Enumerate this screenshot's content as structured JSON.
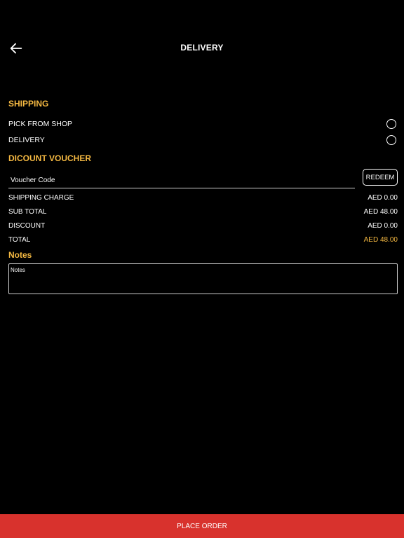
{
  "header": {
    "title": "DELIVERY",
    "back_icon": "arrow-left-icon"
  },
  "shipping": {
    "title": "SHIPPING",
    "options": [
      {
        "label": "PICK FROM SHOP",
        "selected": false
      },
      {
        "label": "DELIVERY",
        "selected": false
      }
    ]
  },
  "voucher": {
    "title": "DICOUNT VOUCHER",
    "placeholder": "Voucher Code",
    "value": "",
    "redeem_label": "REDEEM"
  },
  "summary": {
    "rows": [
      {
        "label": "SHIPPING CHARGE",
        "value": "AED 0.00"
      },
      {
        "label": "SUB TOTAL",
        "value": "AED 48.00"
      },
      {
        "label": "DISCOUNT",
        "value": "AED 0.00"
      },
      {
        "label": "TOTAL",
        "value": "AED 48.00"
      }
    ]
  },
  "notes": {
    "title": "Notes",
    "placeholder": "Notes",
    "value": ""
  },
  "footer": {
    "place_order_label": "PLACE ORDER"
  },
  "colors": {
    "background": "#000000",
    "accent": "#f5b942",
    "primary_button": "#d8322d",
    "text": "#ffffff"
  }
}
